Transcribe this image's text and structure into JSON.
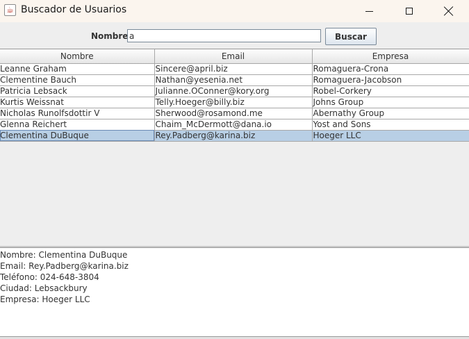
{
  "window": {
    "title": "Buscador de Usuarios",
    "icon": "java-icon"
  },
  "search": {
    "label": "Nombre:",
    "value": "a",
    "button_label": "Buscar"
  },
  "table": {
    "columns": [
      "Nombre",
      "Email",
      "Empresa"
    ],
    "rows": [
      [
        "Leanne Graham",
        "Sincere@april.biz",
        "Romaguera-Crona"
      ],
      [
        "Clementine Bauch",
        "Nathan@yesenia.net",
        "Romaguera-Jacobson"
      ],
      [
        "Patricia Lebsack",
        "Julianne.OConner@kory.org",
        "Robel-Corkery"
      ],
      [
        "Kurtis Weissnat",
        "Telly.Hoeger@billy.biz",
        "Johns Group"
      ],
      [
        "Nicholas Runolfsdottir V",
        "Sherwood@rosamond.me",
        "Abernathy Group"
      ],
      [
        "Glenna Reichert",
        "Chaim_McDermott@dana.io",
        "Yost and Sons"
      ],
      [
        "Clementina DuBuque",
        "Rey.Padberg@karina.biz",
        "Hoeger LLC"
      ]
    ],
    "selected_row": 6,
    "selection_color": "#b8cfe5"
  },
  "details": {
    "lines": [
      "Nombre: Clementina DuBuque",
      "Email: Rey.Padberg@karina.biz",
      "Teléfono: 024-648-3804",
      "Ciudad: Lebsackbury",
      "Empresa: Hoeger LLC"
    ]
  }
}
